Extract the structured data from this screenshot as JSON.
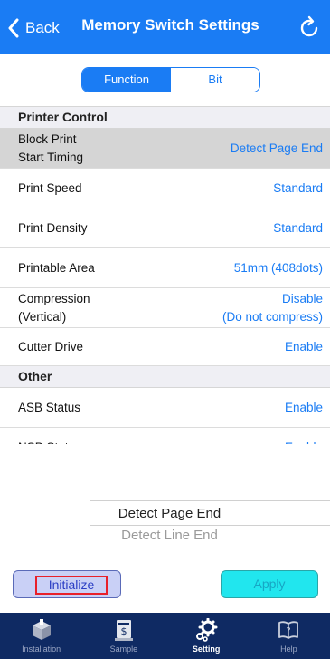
{
  "nav": {
    "back_label": "Back",
    "title": "Memory Switch Settings"
  },
  "segment": {
    "options": [
      "Function",
      "Bit"
    ],
    "selected": "Function"
  },
  "list": {
    "sections": [
      {
        "header": "Printer Control",
        "rows": [
          {
            "label_line1": "Block Print",
            "label_line2": "Start Timing",
            "value": "Detect Page End",
            "selected": true
          },
          {
            "label": "Print Speed",
            "value": "Standard"
          },
          {
            "label": "Print Density",
            "value": "Standard"
          },
          {
            "label": "Printable Area",
            "value": "51mm (408dots)"
          },
          {
            "label_line1": "Compression",
            "label_line2": "(Vertical)",
            "value_line1": "Disable",
            "value_line2": "(Do not compress)"
          },
          {
            "label": "Cutter Drive",
            "value": "Enable"
          }
        ]
      },
      {
        "header": "Other",
        "rows": [
          {
            "label": "ASB Status",
            "value": "Enable"
          },
          {
            "label": "NSB Status",
            "value": "Enable"
          }
        ]
      }
    ]
  },
  "picker": {
    "selected": "Detect Page End",
    "next": "Detect Line End"
  },
  "buttons": {
    "initialize": "Initialize",
    "apply": "Apply"
  },
  "tabbar": {
    "tabs": [
      {
        "label": "Installation",
        "icon": "box-icon"
      },
      {
        "label": "Sample",
        "icon": "receipt-icon"
      },
      {
        "label": "Setting",
        "icon": "gears-icon",
        "active": true
      },
      {
        "label": "Help",
        "icon": "book-question-icon"
      }
    ]
  },
  "colors": {
    "nav_blue": "#1a7cf4",
    "tabbar_navy": "#0f2a63",
    "value_blue": "#1a7cf4",
    "initialize_bg": "#c9d0f6",
    "apply_bg": "#21e6ee",
    "highlight_red": "#e8202a"
  }
}
